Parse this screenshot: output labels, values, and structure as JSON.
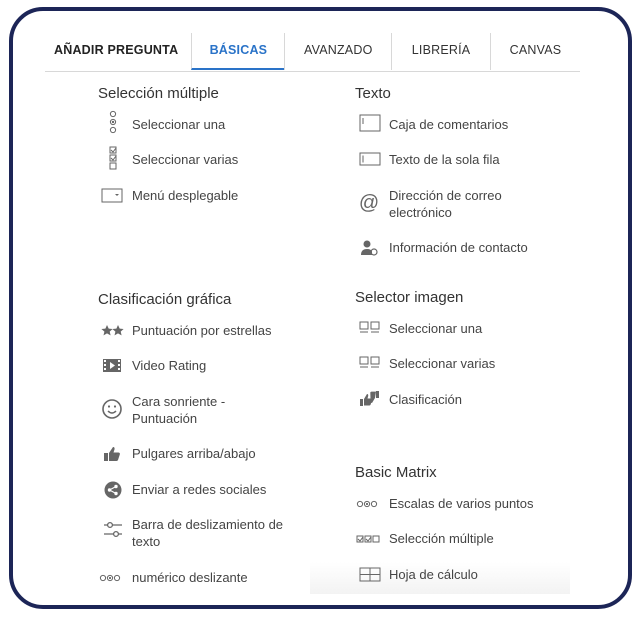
{
  "tabs": {
    "title": "AÑADIR PREGUNTA",
    "basicas": "BÁSICAS",
    "avanzado": "AVANZADO",
    "libreria": "LIBRERÍA",
    "canvas": "CANVAS"
  },
  "seleccion_multiple": {
    "heading": "Selección múltiple",
    "items": [
      "Seleccionar una",
      "Seleccionar varias",
      "Menú desplegable"
    ]
  },
  "texto": {
    "heading": "Texto",
    "items": [
      "Caja de comentarios",
      "Texto de la sola fila",
      "Dirección de correo",
      "electrónico",
      "Información de contacto"
    ]
  },
  "clasificacion_grafica": {
    "heading": "Clasificación gráfica",
    "items": [
      "Puntuación por estrellas",
      "Video Rating",
      "Cara sonriente -",
      "Puntuación",
      "Pulgares arriba/abajo",
      "Enviar a redes sociales",
      "Barra de deslizamiento de",
      "texto",
      "numérico deslizante"
    ]
  },
  "selector_imagen": {
    "heading": "Selector imagen",
    "items": [
      "Seleccionar una",
      "Seleccionar varias",
      "Clasificación"
    ]
  },
  "basic_matrix": {
    "heading": "Basic Matrix",
    "items": [
      "Escalas de varios puntos",
      "Selección múltiple",
      "Hoja de cálculo"
    ]
  },
  "colors": {
    "accent": "#2a73c8",
    "frame": "#1c2557"
  }
}
